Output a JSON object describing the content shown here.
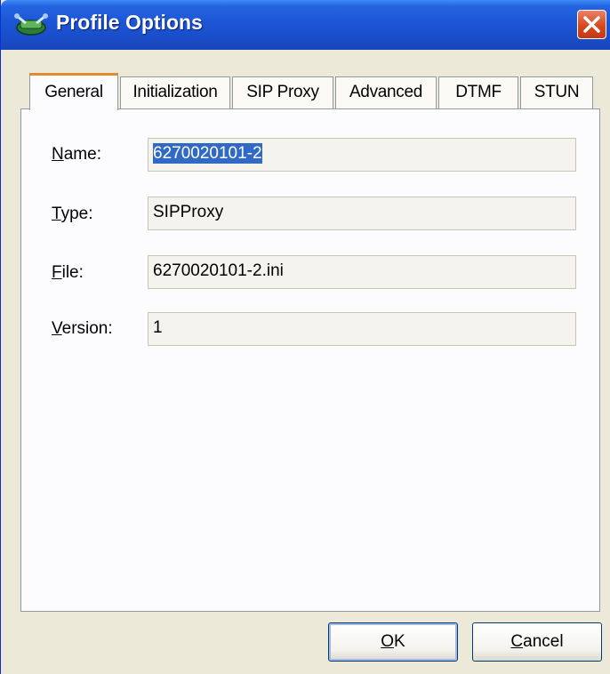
{
  "window": {
    "title": "Profile Options",
    "icon": "network-profile-icon",
    "close_icon": "close-icon"
  },
  "tabs": [
    {
      "label": "General",
      "active": true
    },
    {
      "label": "Initialization",
      "active": false
    },
    {
      "label": "SIP Proxy",
      "active": false
    },
    {
      "label": "Advanced",
      "active": false
    },
    {
      "label": "DTMF",
      "active": false
    },
    {
      "label": "STUN",
      "active": false
    }
  ],
  "fields": {
    "name": {
      "mnemonic": "N",
      "label_rest": "ame:",
      "value": "6270020101-2"
    },
    "type": {
      "mnemonic": "T",
      "label_rest": "ype:",
      "value": "SIPProxy"
    },
    "file": {
      "mnemonic": "F",
      "label_rest": "ile:",
      "value": "6270020101-2.ini"
    },
    "version": {
      "mnemonic": "V",
      "label_rest": "ersion:",
      "value": "1"
    }
  },
  "buttons": {
    "ok": {
      "mnemonic": "O",
      "rest": "K"
    },
    "cancel": {
      "mnemonic": "C",
      "rest": "ancel"
    }
  },
  "colors": {
    "titlebar": "#1B55D6",
    "dialog_bg": "#ECE9D8",
    "tab_highlight": "#E68B2C",
    "selection": "#316AC5",
    "close_button": "#D9481E"
  }
}
